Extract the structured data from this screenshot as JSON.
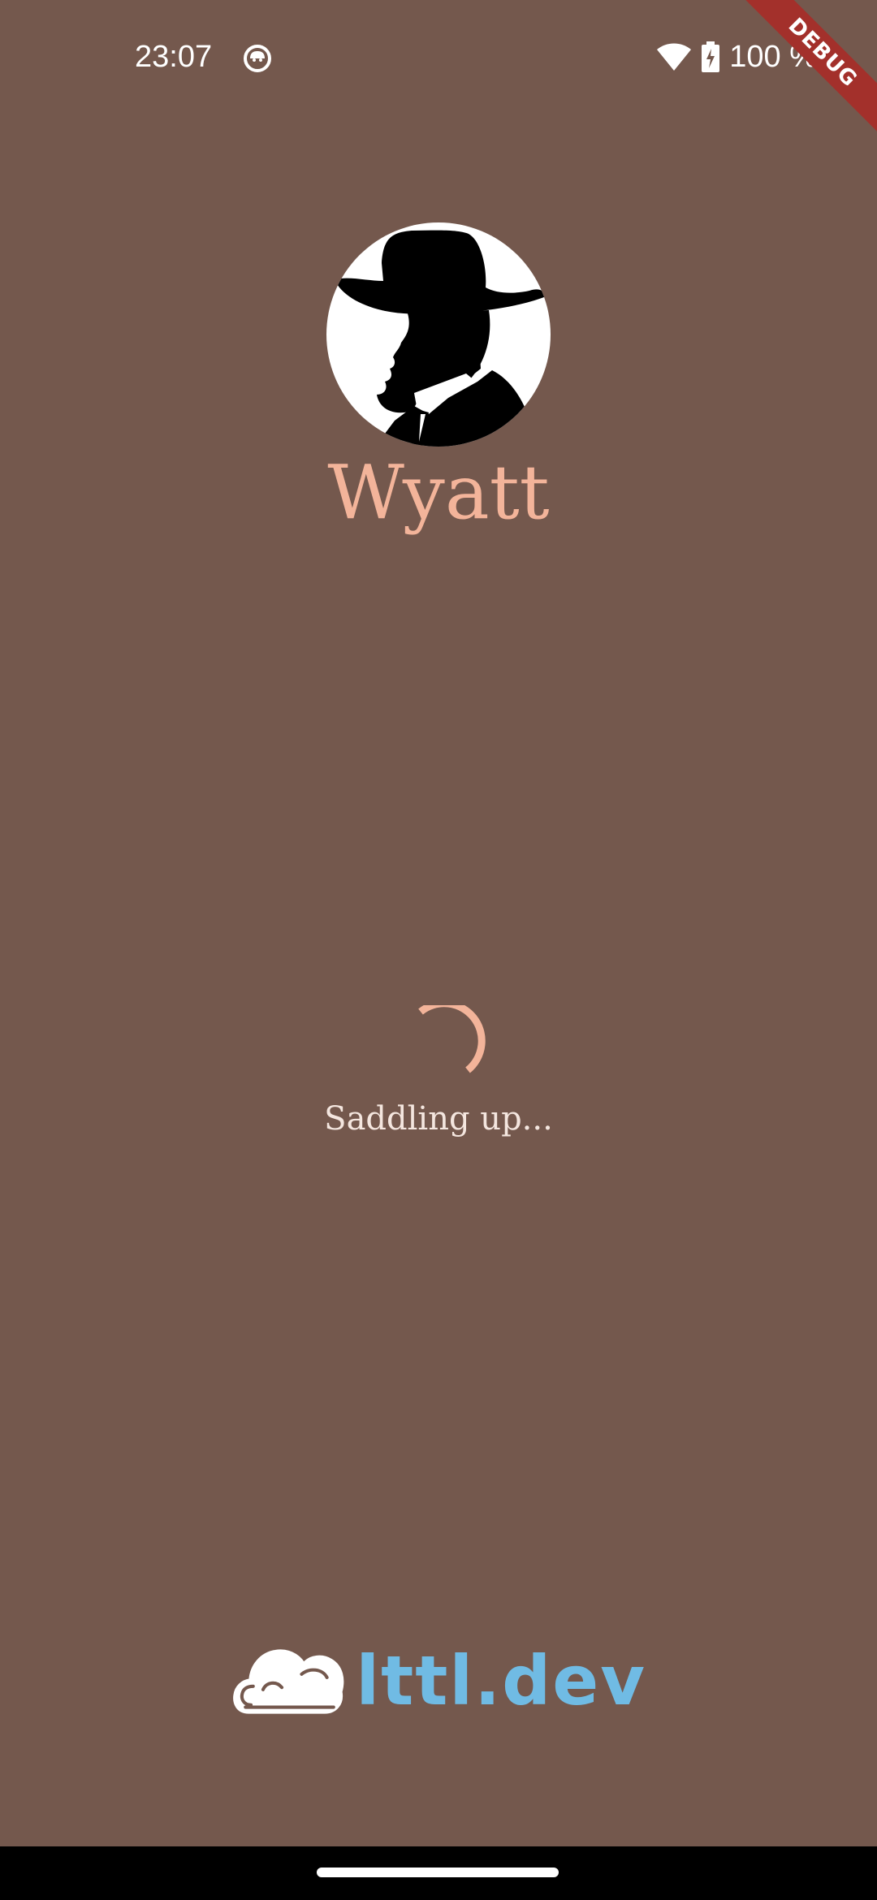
{
  "status_bar": {
    "time": "23:07",
    "app_icon": "cat-face-icon",
    "wifi_icon": "wifi-icon",
    "battery_icon": "battery-charging-icon",
    "battery_text": "100 %"
  },
  "debug_banner": {
    "label": "DEBUG",
    "color": "#a3302b"
  },
  "splash": {
    "avatar_icon": "cowboy-silhouette-icon",
    "app_name": "Wyatt",
    "loading_text": "Saddling up...",
    "spinner_icon": "progress-spinner-icon"
  },
  "footer": {
    "logo_icon": "cloud-icon",
    "logo_text": "lttl.dev"
  },
  "colors": {
    "background": "#74584d",
    "accent": "#f3b49a",
    "logo_blue": "#70bbe4"
  }
}
